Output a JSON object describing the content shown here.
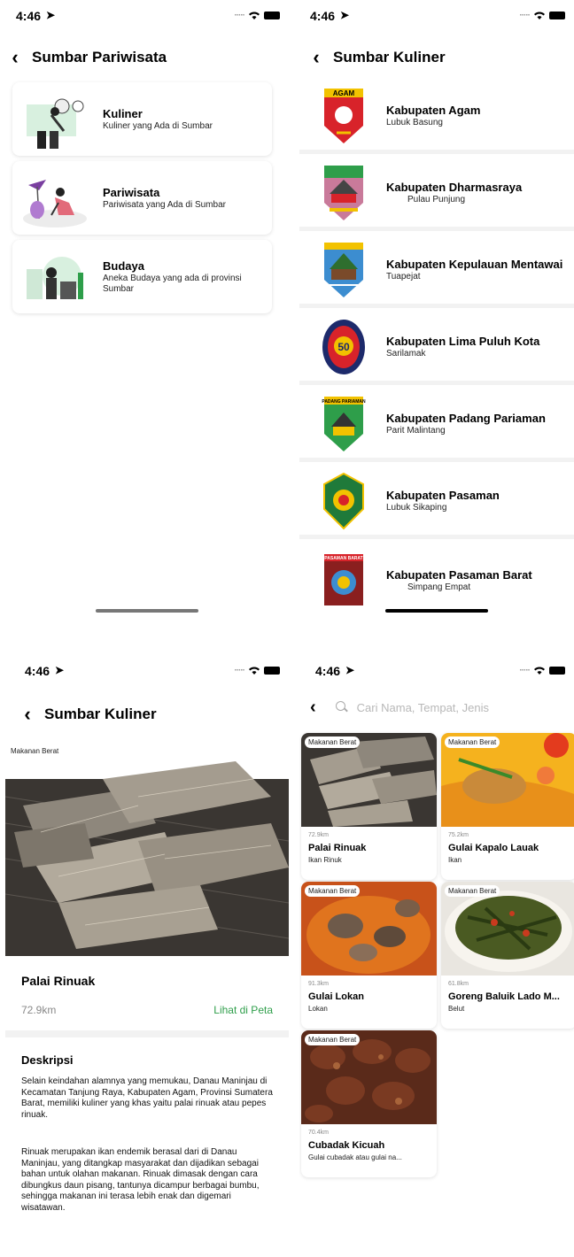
{
  "status": {
    "time": "4:46",
    "location_icon": "location-arrow-icon",
    "wifi_icon": "wifi-icon",
    "battery_icon": "battery-icon"
  },
  "screen_categories": {
    "title": "Sumbar Pariwisata",
    "items": [
      {
        "title": "Kuliner",
        "subtitle": "Kuliner yang Ada di Sumbar",
        "icon": "cooking-illustration"
      },
      {
        "title": "Pariwisata",
        "subtitle": "Pariwisata yang Ada di Sumbar",
        "icon": "tourism-illustration"
      },
      {
        "title": "Budaya",
        "subtitle": "Aneka Budaya yang ada di provinsi Sumbar",
        "icon": "culture-illustration"
      }
    ]
  },
  "screen_regencies": {
    "title": "Sumbar Kuliner",
    "items": [
      {
        "name": "Kabupaten Agam",
        "city": "Lubuk Basung",
        "logo_text": "AGAM"
      },
      {
        "name": "Kabupaten Dharmasraya",
        "city": "Pulau Punjung",
        "logo_text": ""
      },
      {
        "name": "Kabupaten Kepulauan Mentawai",
        "city": "Tuapejat",
        "logo_text": ""
      },
      {
        "name": "Kabupaten Lima Puluh Kota",
        "city": "Sarilamak",
        "logo_text": "50"
      },
      {
        "name": "Kabupaten Padang Pariaman",
        "city": "Parit Malintang",
        "logo_text": "PADANG PARIAMAN"
      },
      {
        "name": "Kabupaten Pasaman",
        "city": "Lubuk Sikaping",
        "logo_text": ""
      },
      {
        "name": "Kabupaten Pasaman Barat",
        "city": "Simpang Empat",
        "logo_text": "PASAMAN BARAT"
      }
    ]
  },
  "screen_detail": {
    "title": "Sumbar Kuliner",
    "tag": "Makanan Berat",
    "name": "Palai Rinuak",
    "distance": "72.9km",
    "map_link": "Lihat di Peta",
    "desc_heading": "Deskripsi",
    "desc_p1": "Selain keindahan alamnya yang memukau, Danau Maninjau di Kecamatan Tanjung Raya, Kabupaten Agam, Provinsi Sumatera Barat, memiliki kuliner yang khas yaitu palai rinuak atau pepes rinuak.",
    "desc_p2": "Rinuak merupakan ikan endemik berasal dari di Danau Maninjau, yang ditangkap masyarakat dan dijadikan sebagai bahan untuk olahan makanan. Rinuak dimasak dengan cara dibungkus daun pisang, tantunya dicampur berbagai bumbu, sehingga makanan ini terasa lebih enak dan digemari wisatawan.",
    "colors": {
      "map_link": "#2e9e4a"
    }
  },
  "screen_search": {
    "placeholder": "Cari Nama, Tempat, Jenis",
    "items": [
      {
        "tag": "Makanan Berat",
        "distance": "72.9km",
        "name": "Palai Rinuak",
        "sub": "Ikan Rinuk"
      },
      {
        "tag": "Makanan Berat",
        "distance": "75.2km",
        "name": "Gulai Kapalo Lauak",
        "sub": "Ikan"
      },
      {
        "tag": "Makanan Berat",
        "distance": "91.3km",
        "name": "Gulai Lokan",
        "sub": "Lokan"
      },
      {
        "tag": "Makanan Berat",
        "distance": "61.8km",
        "name": "Goreng Baluik Lado M...",
        "sub": "Belut"
      },
      {
        "tag": "Makanan Berat",
        "distance": "70.4km",
        "name": "Cubadak Kicuah",
        "sub": "Gulai cubadak atau gulai na..."
      }
    ]
  }
}
